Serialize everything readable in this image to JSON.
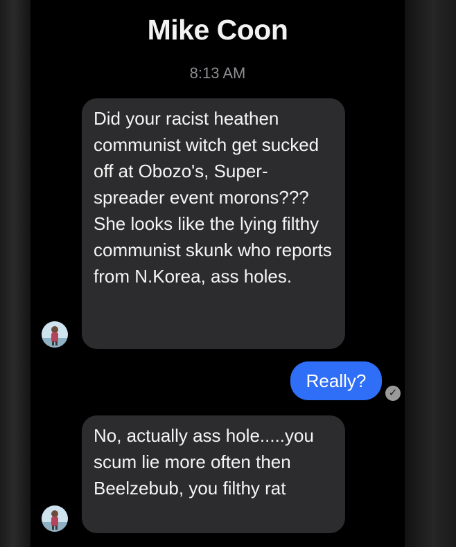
{
  "header": {
    "contact_name": "Mike Coon",
    "timestamp": "8:13 AM"
  },
  "messages": [
    {
      "sender": "incoming",
      "text": "Did your racist heathen communist witch get sucked off at Obozo's, Super-spreader event morons???She looks like the lying filthy communist skunk who reports from N.Korea, ass holes."
    },
    {
      "sender": "outgoing",
      "text": "Really?",
      "status_icon": "checkmark-circle-icon"
    },
    {
      "sender": "incoming",
      "text": "No, actually ass hole.....you scum lie more often then Beelzebub, you filthy rat"
    }
  ],
  "colors": {
    "background": "#000000",
    "incoming_bubble": "#2c2c2e",
    "outgoing_bubble": "#2f6ef7",
    "timestamp_text": "#8e8e93"
  },
  "icons": {
    "avatar": "avatar-icon",
    "read_receipt": "checkmark-circle-icon"
  }
}
